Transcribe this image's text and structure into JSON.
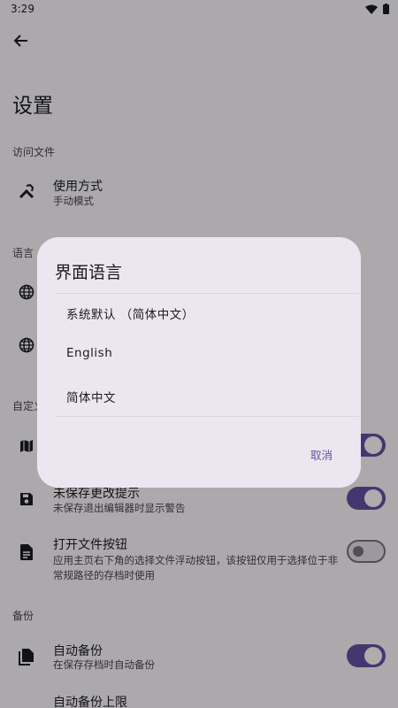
{
  "status_bar": {
    "time": "3:29"
  },
  "page": {
    "title": "设置"
  },
  "sections": {
    "files": "访问文件",
    "language_partial": "语言",
    "custom_partial": "自定义",
    "backup": "备份"
  },
  "rows": {
    "usage_mode": {
      "title": "使用方式",
      "subtitle": "手动模式"
    },
    "unsaved_prompt": {
      "title": "未保存更改提示",
      "subtitle": "未保存退出编辑器时显示警告",
      "switch_on": true
    },
    "open_file_button": {
      "title": "打开文件按钮",
      "subtitle": "应用主页右下角的选择文件浮动按钮，该按钮仅用于选择位于非常规路径的存档时使用",
      "switch_on": false
    },
    "auto_backup": {
      "title": "自动备份",
      "subtitle": "在保存存档时自动备份",
      "switch_on": true
    },
    "auto_backup_limit": {
      "title": "自动备份上限"
    }
  },
  "dialog": {
    "title": "界面语言",
    "options": [
      "系统默认 （简体中文）",
      "English",
      "简体中文"
    ],
    "cancel_label": "取消"
  },
  "colors": {
    "accent": "#6750a4",
    "dialog_bg": "#ece6f0",
    "scrim": "rgba(0,0,0,0.32)"
  }
}
